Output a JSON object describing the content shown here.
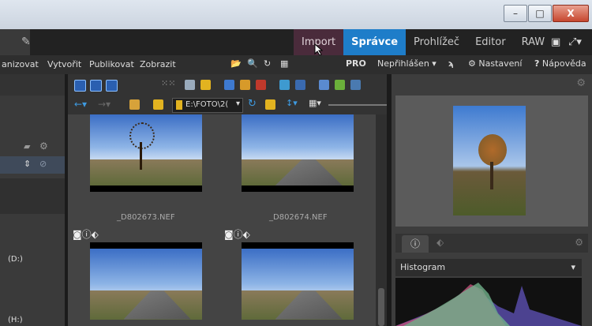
{
  "window": {
    "controls": [
      "–",
      "□",
      "X"
    ]
  },
  "mode_tabs": [
    {
      "label": "Import"
    },
    {
      "label": "Správce"
    },
    {
      "label": "Prohlížeč"
    },
    {
      "label": "Editor"
    },
    {
      "label": "RAW"
    }
  ],
  "menu": {
    "items": [
      "anizovat",
      "Vytvořit",
      "Publikovat",
      "Zobrazit"
    ],
    "pro_label": "PRO",
    "login_label": "Nepřihlášen",
    "settings_label": "Nastavení",
    "help_label": "Nápověda"
  },
  "toolbar": {
    "path_value": "E:\\FOTO\\2("
  },
  "left_panel": {
    "drives": [
      "(D:)",
      "(H:)"
    ]
  },
  "thumbnails": [
    {
      "filename": "_D802673.NEF"
    },
    {
      "filename": "_D802674.NEF"
    }
  ],
  "right_panel": {
    "histogram_title": "Histogram"
  },
  "colors": {
    "accent": "#1e7dc9",
    "import_tab": "#4a2b3b"
  }
}
